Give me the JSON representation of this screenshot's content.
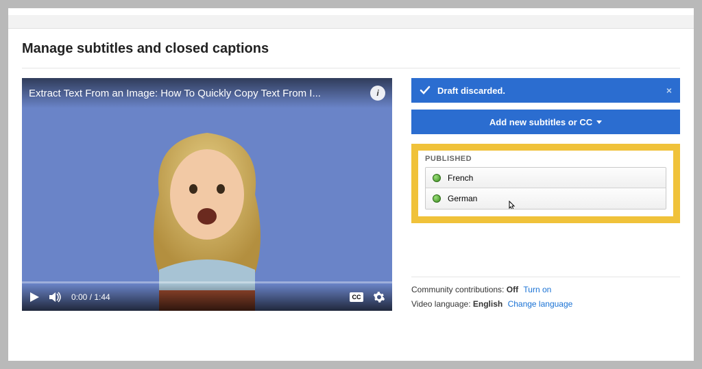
{
  "page_title": "Manage subtitles and closed captions",
  "video": {
    "title": "Extract Text From an Image: How To Quickly Copy Text From I...",
    "current_time": "0:00",
    "duration": "1:44",
    "cc_label": "CC"
  },
  "banner": {
    "message": "Draft discarded.",
    "close": "×"
  },
  "add_button": {
    "label": "Add new subtitles or CC"
  },
  "published": {
    "heading": "PUBLISHED",
    "languages": [
      {
        "name": "French"
      },
      {
        "name": "German"
      }
    ]
  },
  "footer": {
    "community_label": "Community contributions:",
    "community_value": "Off",
    "community_action": "Turn on",
    "lang_label": "Video language:",
    "lang_value": "English",
    "lang_action": "Change language"
  }
}
